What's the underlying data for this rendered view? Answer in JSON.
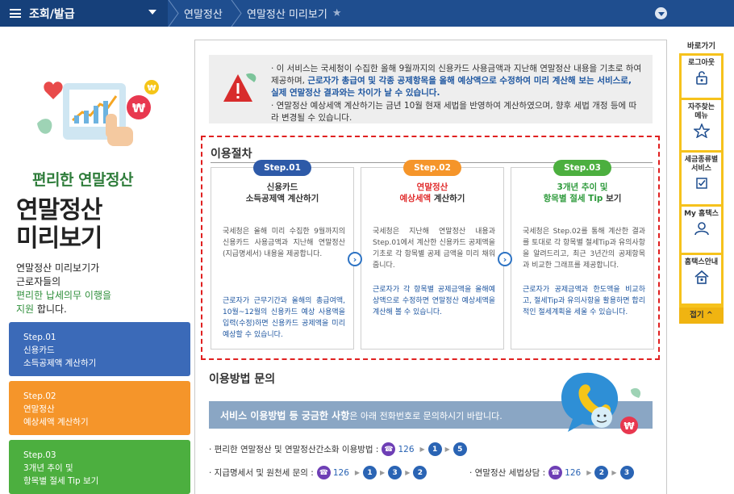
{
  "topbar": {
    "menu_label": "조회/발급",
    "breadcrumb_1": "연말정산",
    "breadcrumb_2": "연말정산 미리보기"
  },
  "left": {
    "brand_title": "편리한 연말정산",
    "big_title_1": "연말정산",
    "big_title_2": "미리보기",
    "desc_1": "연말정산 미리보기가",
    "desc_2": "근로자들의",
    "desc_3_hl": "편리한 납세의무 이행을",
    "desc_4_hl": "지원",
    "desc_4_rest": " 합니다.",
    "steps": [
      {
        "line1": "Step.01",
        "line2": "신용카드",
        "line3": "소득공제액 계산하기"
      },
      {
        "line1": "Step.02",
        "line2": "연말정산",
        "line3": "예상세액 계산하기"
      },
      {
        "line1": "Step.03",
        "line2": "3개년 추이 및",
        "line3": "항목별 절세 Tip 보기"
      }
    ]
  },
  "notice": {
    "p1_a": "· 이 서비스는 국세청이 수집한 올해 9월까지의 신용카드 사용금액과 지난해 연말정산 내용을 기초로 하여 제공하며, ",
    "p1_b": "근로자가 총급여 및 각종 공제항목을 올해 예상액으로 수정하여 미리 계산해 보는 서비스로, 실제 연말정산 결과와는 차이가 날 수 있습니다.",
    "p2": "· 연말정산 예상세액 계산하기는 금년 10월 현재 세법을 반영하여 계산하였으며, 향후 세법 개정 등에 따라 변경될 수 있습니다."
  },
  "procedure": {
    "title": "이용절차",
    "steps": [
      {
        "pill": "Step.01",
        "title_1": "신용카드",
        "title_2": "소득공제액 계산하기",
        "body": "국세청은 올해 미리 수집한 9월까지의 신용카드 사용금액과 지난해 연말정산(지급명세서) 내용을 제공합니다.",
        "blue": "근로자가 근무기간과 올해의 총급여액, 10월~12월의 신용카드 예상 사용액을 입력(수정)하면 신용카드 공제액을 미리 예상할 수 있습니다."
      },
      {
        "pill": "Step.02",
        "title_1": "연말정산",
        "title_2_red": "예상세액",
        "title_2_rest": " 계산하기",
        "body": "국세청은 지난해 연말정산 내용과 Step.01에서 계산한 신용카드 공제액을 기초로 각 항목별 공제 금액을 미리 채워줍니다.",
        "blue": "근로자가 각 항목별 공제금액을 올해예상액으로 수정하면 연말정산 예상세액을 계산해 볼 수 있습니다."
      },
      {
        "pill": "Step.03",
        "title_1": "3개년 추이 및",
        "title_2_grn": "항목별 절세 Tip",
        "title_2_rest": " 보기",
        "body": "국세청은 Step.02를 통해 계산한 결과를 토대로 각 항목별 절세Tip과 유의사항을 알려드리고, 최근 3년간의 공제항목과 비교한 그래프를 제공합니다.",
        "blue": "근로자가 공제금액과 한도액을 비교하고, 절세Tip과 유의사항을 활용하면 합리적인 절세계획을 세울 수 있습니다."
      }
    ]
  },
  "inquiry": {
    "title": "이용방법 문의",
    "banner_bold": "서비스 이용방법 등 궁금한 사항",
    "banner_rest": "은 아래 전화번호로 문의하시기 바랍니다.",
    "row1_label": "· 편리한 연말정산 및 연말정산간소화 이용방법 :",
    "row1_phone": "126",
    "row1_n1": "1",
    "row1_n2": "5",
    "row2_label": "· 지급명세서 및 원천세 문의 :",
    "row2_phone": "126",
    "row2_n1": "1",
    "row2_n2": "3",
    "row2_n3": "2",
    "row3_label": "· 연말정산 세법상담 :",
    "row3_phone": "126",
    "row3_n1": "2",
    "row3_n2": "3"
  },
  "quick": {
    "head": "바로가기",
    "items": [
      {
        "label": "로그아웃"
      },
      {
        "label_1": "자주찾는",
        "label_2": "메뉴"
      },
      {
        "label_1": "세금종류별",
        "label_2": "서비스"
      },
      {
        "label": "My 홈택스"
      },
      {
        "label": "홈택스안내"
      }
    ],
    "close": "접기 ^"
  }
}
